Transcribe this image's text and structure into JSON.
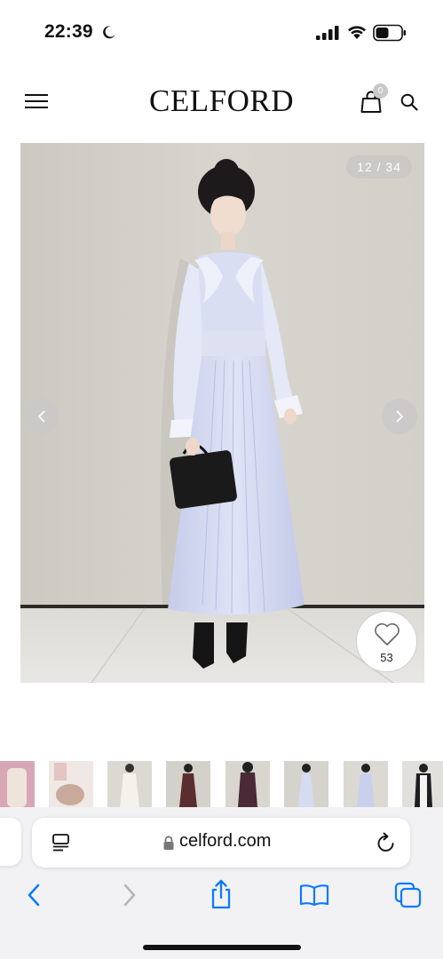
{
  "status_bar": {
    "time": "22:39",
    "icons": [
      "moon-icon",
      "signal-icon",
      "wifi-icon",
      "battery-icon"
    ]
  },
  "header": {
    "brand": "CELFORD",
    "cart_count": "0",
    "icons": [
      "menu-icon",
      "cart-icon",
      "search-icon"
    ]
  },
  "gallery": {
    "counter": "12 / 34",
    "favorite_count": "53",
    "icons": [
      "chevron-left-icon",
      "chevron-right-icon",
      "heart-icon"
    ]
  },
  "thumbnails": {
    "count": 8
  },
  "browser": {
    "address": "celford.com",
    "icons": [
      "reader-icon",
      "lock-icon",
      "reload-icon",
      "back-icon",
      "forward-icon",
      "share-icon",
      "bookmarks-icon",
      "tabs-icon"
    ],
    "accent": "#0a7aff",
    "disabled": "#b5b5b8"
  }
}
